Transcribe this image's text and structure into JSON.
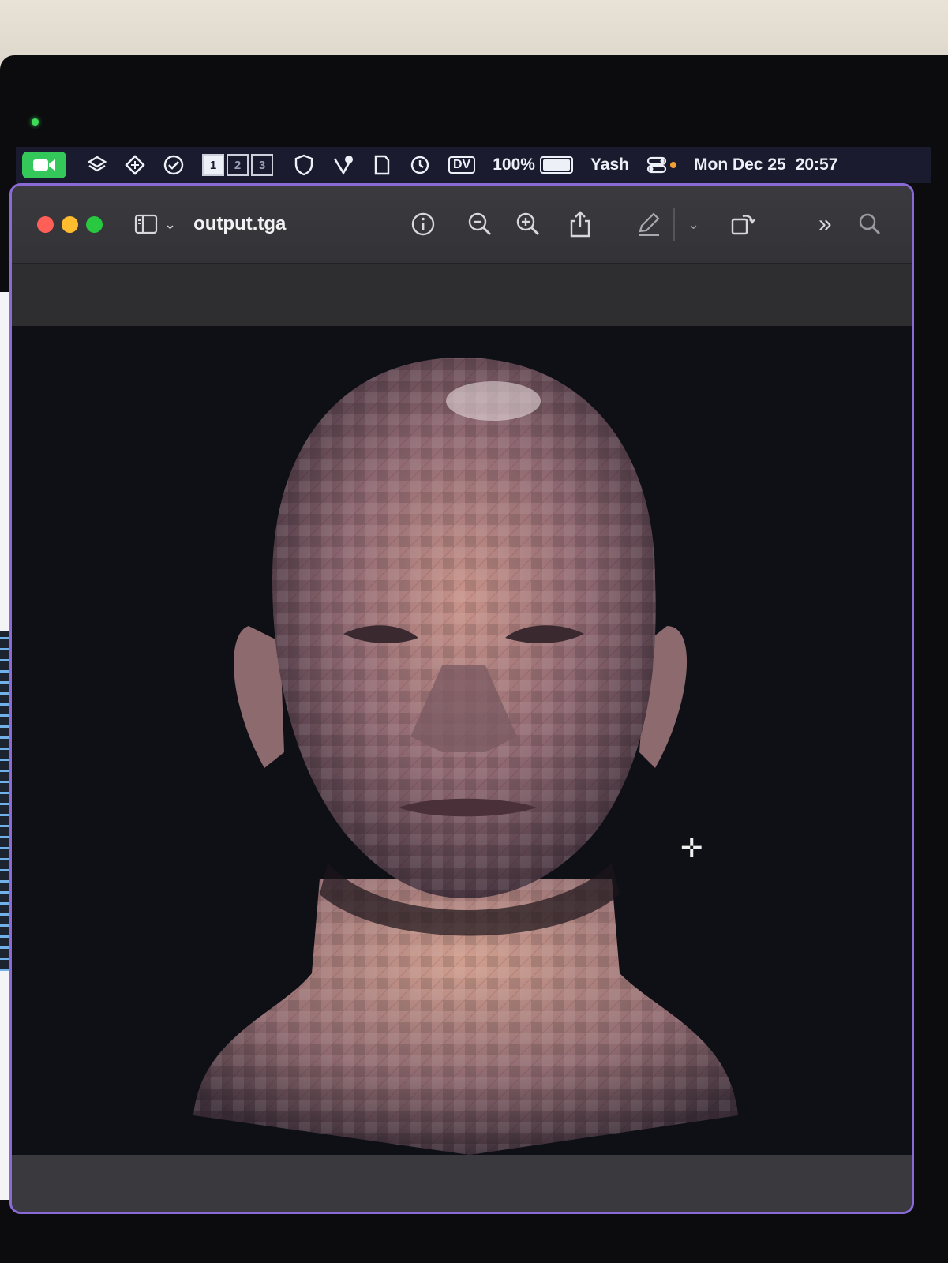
{
  "menubar": {
    "icons": [
      "facetime-camera-icon",
      "layers-icon",
      "diamond-app-icon",
      "checkmark-circle-icon",
      "shield-icon",
      "heart-check-icon",
      "document-app-icon",
      "clock-history-icon"
    ],
    "spaces": [
      "1",
      "2",
      "3"
    ],
    "dv_label": "DV",
    "battery_percent": "100%",
    "user": "Yash",
    "date": "Mon Dec 25",
    "time": "20:57"
  },
  "window": {
    "title": "output.tga",
    "accent_border": "#8a6bd6",
    "toolbar_icons": [
      "sidebar-toggle-icon",
      "info-icon",
      "zoom-out-icon",
      "zoom-in-icon",
      "share-icon",
      "markup-pen-icon",
      "rotate-icon",
      "more-chevrons-icon",
      "search-icon"
    ]
  },
  "colors": {
    "close": "#ff5f57",
    "minimize": "#febc2e",
    "zoom": "#28c840"
  }
}
